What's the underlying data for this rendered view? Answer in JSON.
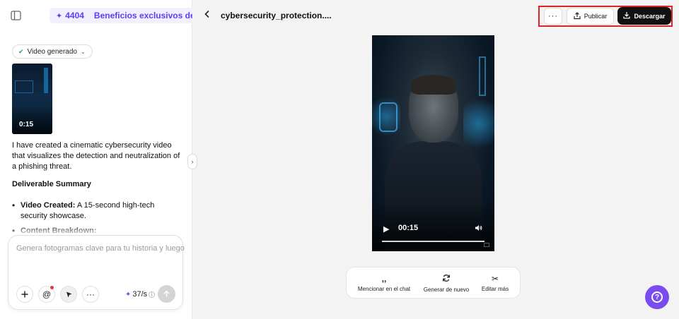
{
  "sidebar": {
    "promo": {
      "credits": "4404",
      "text": "Beneficios exclusivos de Seedance"
    },
    "chip_label": "Video generado",
    "thumbnail_duration": "0:15",
    "message": {
      "intro": "I have created a cinematic cybersecurity video that visualizes the detection and neutralization of a phishing threat.",
      "heading": "Deliverable Summary",
      "bullets": [
        {
          "bold": "Video Created:",
          "text": " A 15-second high-tech security showcase."
        },
        {
          "bold": "Content Breakdown:",
          "text": ""
        }
      ]
    },
    "composer": {
      "placeholder": "Genera fotogramas clave para tu historia y luego",
      "credits": "37/s"
    }
  },
  "header": {
    "title": "cybersecurity_protection....",
    "publish_label": "Publicar",
    "download_label": "Descargar"
  },
  "video": {
    "time": "00:15"
  },
  "toolbar": {
    "mention": "Mencionar en el chat",
    "regenerate": "Generar de nuevo",
    "edit": "Editar más"
  },
  "icons": [
    "sidebar-toggle-icon",
    "sparkle-icon",
    "check-icon",
    "chevron-down-icon",
    "plus-icon",
    "at-icon",
    "cursor-icon",
    "more-icon",
    "arrow-up-icon",
    "chevron-left-icon",
    "chevron-right-icon",
    "share-icon",
    "download-icon",
    "play-icon",
    "volume-icon",
    "quote-icon",
    "refresh-icon",
    "scissors-icon",
    "help-icon"
  ],
  "colors": {
    "accent": "#6f4ff2",
    "highlight_border": "#e02424",
    "primary_button": "#111111"
  }
}
